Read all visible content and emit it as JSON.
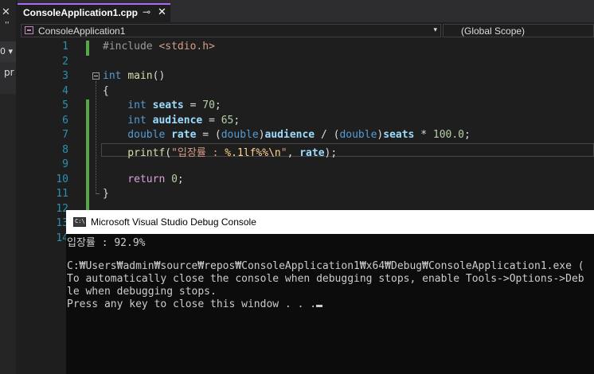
{
  "left_panel": {
    "close_glyph": "✕",
    "dots": "''",
    "dropdown_glyph": "0 ▾",
    "row_text": "pr"
  },
  "tab": {
    "title": "ConsoleApplication1.cpp",
    "pin_glyph": "⊸",
    "close_glyph": "✕"
  },
  "navbar": {
    "project": "ConsoleApplication1",
    "scope": "(Global Scope)",
    "dropdown_glyph": "▾"
  },
  "editor": {
    "line_numbers": [
      "1",
      "2",
      "3",
      "4",
      "5",
      "6",
      "7",
      "8",
      "9",
      "10",
      "11",
      "12",
      "13",
      "14"
    ],
    "lines": [
      {
        "tokens": [
          {
            "t": "#include ",
            "c": "pp"
          },
          {
            "t": "<stdio.h>",
            "c": "inc"
          }
        ]
      },
      {
        "tokens": []
      },
      {
        "tokens": [
          {
            "t": "int ",
            "c": "ty"
          },
          {
            "t": "main",
            "c": "fn"
          },
          {
            "t": "()",
            "c": ""
          }
        ]
      },
      {
        "tokens": [
          {
            "t": "{",
            "c": ""
          }
        ]
      },
      {
        "tokens": [
          {
            "t": "    int ",
            "c": "ty"
          },
          {
            "t": "seats",
            "c": "var bold"
          },
          {
            "t": " = ",
            "c": ""
          },
          {
            "t": "70",
            "c": "num"
          },
          {
            "t": ";",
            "c": ""
          }
        ]
      },
      {
        "tokens": [
          {
            "t": "    int ",
            "c": "ty"
          },
          {
            "t": "audience",
            "c": "var bold"
          },
          {
            "t": " = ",
            "c": ""
          },
          {
            "t": "65",
            "c": "num"
          },
          {
            "t": ";",
            "c": ""
          }
        ]
      },
      {
        "tokens": [
          {
            "t": "    double ",
            "c": "ty"
          },
          {
            "t": "rate",
            "c": "var bold"
          },
          {
            "t": " = (",
            "c": ""
          },
          {
            "t": "double",
            "c": "ty"
          },
          {
            "t": ")",
            "c": ""
          },
          {
            "t": "audience",
            "c": "var bold"
          },
          {
            "t": " / (",
            "c": ""
          },
          {
            "t": "double",
            "c": "ty"
          },
          {
            "t": ")",
            "c": ""
          },
          {
            "t": "seats",
            "c": "var bold"
          },
          {
            "t": " * ",
            "c": ""
          },
          {
            "t": "100.0",
            "c": "num"
          },
          {
            "t": ";",
            "c": ""
          }
        ]
      },
      {
        "tokens": [
          {
            "t": "    printf",
            "c": "fn"
          },
          {
            "t": "(",
            "c": ""
          },
          {
            "t": "\"입장률 : ",
            "c": "str"
          },
          {
            "t": "%.1lf%%\\n",
            "c": "esc"
          },
          {
            "t": "\"",
            "c": "str"
          },
          {
            "t": ", ",
            "c": ""
          },
          {
            "t": "rate",
            "c": "var bold"
          },
          {
            "t": ");",
            "c": ""
          }
        ]
      },
      {
        "tokens": []
      },
      {
        "tokens": [
          {
            "t": "    return ",
            "c": "ctl"
          },
          {
            "t": "0",
            "c": "num"
          },
          {
            "t": ";",
            "c": ""
          }
        ]
      },
      {
        "tokens": [
          {
            "t": "}",
            "c": ""
          }
        ]
      },
      {
        "tokens": []
      }
    ]
  },
  "console": {
    "title": "Microsoft Visual Studio Debug Console",
    "icon_text": "C:\\",
    "lines": [
      "입장률 : 92.9%",
      "",
      "C:₩Users₩admin₩source₩repos₩ConsoleApplication1₩x64₩Debug₩ConsoleApplication1.exe (",
      "To automatically close the console when debugging stops, enable Tools->Options->Deb",
      "le when debugging stops.",
      "Press any key to close this window . . ."
    ]
  }
}
